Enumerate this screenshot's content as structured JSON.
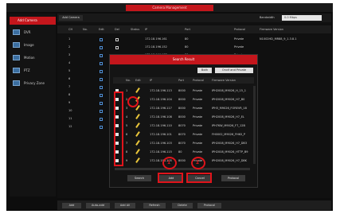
{
  "window": {
    "title": "Camera Management"
  },
  "sidebar": {
    "active": "Add Camera",
    "items": [
      {
        "label": "DVR",
        "icon": "monitor-icon"
      },
      {
        "label": "Image",
        "icon": "image-icon"
      },
      {
        "label": "Motion",
        "icon": "motion-icon"
      },
      {
        "label": "PTZ",
        "icon": "ptz-icon"
      },
      {
        "label": "Privacy Zone",
        "icon": "privacy-icon"
      }
    ]
  },
  "main": {
    "tab": "Add Camera",
    "top_right_label": "Bandwidth",
    "top_right_value": "0.0 Mbps",
    "columns": [
      "CH",
      "No.",
      "Edit",
      "Del",
      "Status",
      "IP",
      "Port",
      "Protocol",
      "Firmware Version"
    ],
    "rows": [
      {
        "ch": "1",
        "ip": "172.18.196.161",
        "port": "80",
        "protocol": "Private",
        "firmware": "N1002HD_MR88_9_1.3.8.1"
      },
      {
        "ch": "2",
        "ip": "172.18.196.152",
        "port": "80",
        "protocol": "Private",
        "firmware": ""
      },
      {
        "ch": "3",
        "ip": "172.18.196.173",
        "port": "80",
        "protocol": "Private",
        "firmware": ""
      },
      {
        "ch": "4",
        "ip": "",
        "port": "",
        "protocol": "Private",
        "firmware": ""
      },
      {
        "ch": "5",
        "ip": "",
        "port": "",
        "protocol": "Private",
        "firmware": ""
      },
      {
        "ch": "6",
        "ip": "",
        "port": "",
        "protocol": "Private",
        "firmware": ""
      },
      {
        "ch": "7",
        "ip": "",
        "port": "",
        "protocol": "",
        "firmware": ""
      },
      {
        "ch": "8",
        "ip": "",
        "port": "",
        "protocol": "",
        "firmware": ""
      },
      {
        "ch": "9",
        "ip": "",
        "port": "",
        "protocol": "",
        "firmware": ""
      },
      {
        "ch": "10",
        "ip": "",
        "port": "",
        "protocol": "",
        "firmware": ""
      },
      {
        "ch": "11",
        "ip": "",
        "port": "",
        "protocol": "",
        "firmware": ""
      },
      {
        "ch": "12",
        "ip": "",
        "port": "",
        "protocol": "",
        "firmware": ""
      }
    ]
  },
  "dialog": {
    "title": "Search Result",
    "filter_label": "Both",
    "filter_value": "Onvif and Private",
    "columns": [
      "",
      "No.",
      "Edit",
      "IP",
      "Port",
      "Protocol",
      "Firmware Version"
    ],
    "rows": [
      {
        "no": "1",
        "ip": "172.18.196.113",
        "port": "8000",
        "protocol": "Private",
        "firmware": "IPH2008_M9026_H_15_1"
      },
      {
        "no": "2",
        "ip": "172.18.196.104",
        "port": "8000",
        "protocol": "Private",
        "firmware": "IPH2008_M9026_H7_B0"
      },
      {
        "no": "3",
        "ip": "172.18.196.117",
        "port": "8000",
        "protocol": "Private",
        "firmware": "IPH3_M9026_FOREVR_18"
      },
      {
        "no": "4",
        "ip": "172.18.196.108",
        "port": "8000",
        "protocol": "Private",
        "firmware": "IPH2008_M9026_H7_EL"
      },
      {
        "no": "5",
        "ip": "172.18.196.110",
        "port": "8070",
        "protocol": "Private",
        "firmware": "IPH7KW_M9026_F7_12B"
      },
      {
        "no": "6",
        "ip": "172.18.196.101",
        "port": "8070",
        "protocol": "Private",
        "firmware": "FH0002_M9026_FHK0_P"
      },
      {
        "no": "7",
        "ip": "172.18.196.103",
        "port": "8070",
        "protocol": "Private",
        "firmware": "IPH2008_M9026_H7_DB3"
      },
      {
        "no": "8",
        "ip": "172.18.196.115",
        "port": "80",
        "protocol": "Private",
        "firmware": "IPH2008_M9026_HTTP_B9"
      },
      {
        "no": "9",
        "ip": "172.18.196.105",
        "port": "8000",
        "protocol": "Private",
        "firmware": "IPH2008_M9026_H7_D8K"
      }
    ],
    "buttons": {
      "search": "Search",
      "add": "Add",
      "cancel": "Cancel",
      "protocol": "Protocol"
    }
  },
  "bottom_bar": [
    "Add",
    "Auto-add",
    "Add All",
    "Refresh",
    "Delete",
    "Protocol"
  ],
  "annotations": [
    {
      "label": "1"
    },
    {
      "label": "2"
    }
  ],
  "colors": {
    "accent": "#c4161c",
    "annotation": "#e0141b",
    "background": "#0d0d0d"
  }
}
